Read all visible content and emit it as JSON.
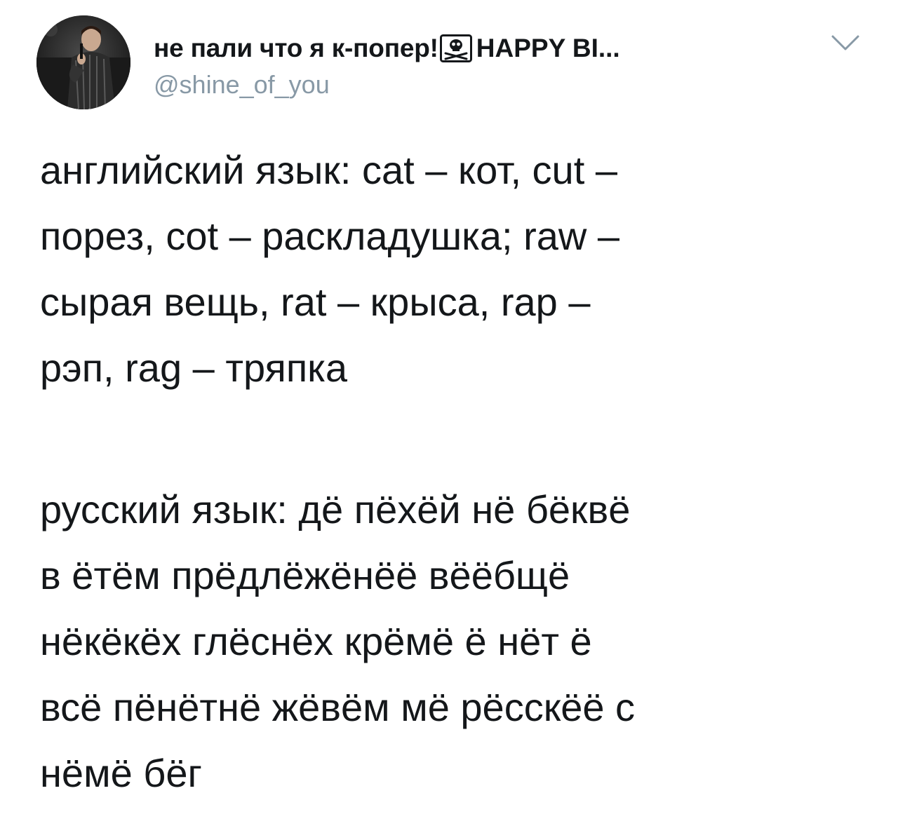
{
  "tweet": {
    "display_name": "не пали что я к-попер!",
    "display_name_tail": "HAPPY BI...",
    "emoji": "skull-and-crossbones",
    "handle": "@shine_of_you",
    "paragraph_1": [
      "английский язык: cat – кот, cut –",
      "порез, cot – раскладушка; raw –",
      "сырая вещь, rat – крыса, rap –",
      "рэп, rag – тряпка"
    ],
    "paragraph_2": [
      "русский язык: дё пёхёй нё бёквё",
      "в ётём прёдлёжёнёё вёёбщё",
      "нёкёкёх глёснёх крёмё ё нёт ё",
      "всё пёнётнё жёвём мё рёсскёё с",
      "нёмё бёг"
    ]
  },
  "colors": {
    "text": "#14171a",
    "secondary": "#8899a6",
    "background": "#ffffff"
  },
  "icons": {
    "caret": "chevron-down-icon",
    "avatar": "user-avatar"
  }
}
